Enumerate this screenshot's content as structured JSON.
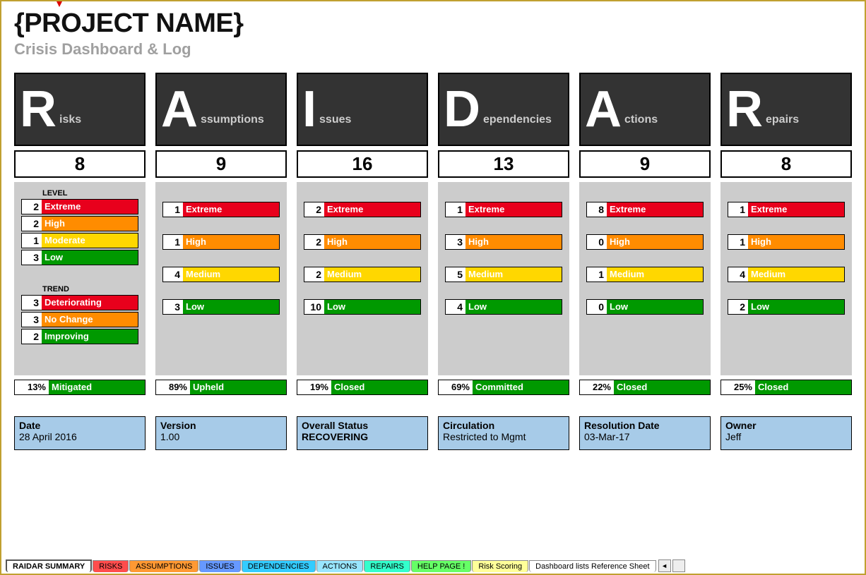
{
  "header": {
    "title": "{PROJECT NAME}",
    "subtitle": "Crisis Dashboard & Log"
  },
  "columns": [
    {
      "letter": "R",
      "word": "isks",
      "count": 8
    },
    {
      "letter": "A",
      "word": "ssumptions",
      "count": 9
    },
    {
      "letter": "I",
      "word": "ssues",
      "count": 16
    },
    {
      "letter": "D",
      "word": "ependencies",
      "count": 13
    },
    {
      "letter": "A",
      "word": "ctions",
      "count": 9
    },
    {
      "letter": "R",
      "word": "epairs",
      "count": 8
    }
  ],
  "risks": {
    "level_label": "LEVEL",
    "levels": [
      {
        "n": 2,
        "label": "Extreme",
        "cls": "c-extreme"
      },
      {
        "n": 2,
        "label": "High",
        "cls": "c-high"
      },
      {
        "n": 1,
        "label": "Moderate",
        "cls": "c-moderate"
      },
      {
        "n": 3,
        "label": "Low",
        "cls": "c-low"
      }
    ],
    "trend_label": "TREND",
    "trends": [
      {
        "n": 3,
        "label": "Deteriorating",
        "cls": "c-deter"
      },
      {
        "n": 3,
        "label": "No Change",
        "cls": "c-nochange"
      },
      {
        "n": 2,
        "label": "Improving",
        "cls": "c-improving"
      }
    ]
  },
  "breakdown": [
    [
      {
        "n": 1,
        "label": "Extreme",
        "cls": "c-extreme"
      },
      {
        "n": 1,
        "label": "High",
        "cls": "c-high"
      },
      {
        "n": 4,
        "label": "Medium",
        "cls": "c-moderate"
      },
      {
        "n": 3,
        "label": "Low",
        "cls": "c-low"
      }
    ],
    [
      {
        "n": 2,
        "label": "Extreme",
        "cls": "c-extreme"
      },
      {
        "n": 2,
        "label": "High",
        "cls": "c-high"
      },
      {
        "n": 2,
        "label": "Medium",
        "cls": "c-moderate"
      },
      {
        "n": 10,
        "label": "Low",
        "cls": "c-low"
      }
    ],
    [
      {
        "n": 1,
        "label": "Extreme",
        "cls": "c-extreme"
      },
      {
        "n": 3,
        "label": "High",
        "cls": "c-high"
      },
      {
        "n": 5,
        "label": "Medium",
        "cls": "c-moderate"
      },
      {
        "n": 4,
        "label": "Low",
        "cls": "c-low"
      }
    ],
    [
      {
        "n": 8,
        "label": "Extreme",
        "cls": "c-extreme"
      },
      {
        "n": 0,
        "label": "High",
        "cls": "c-high"
      },
      {
        "n": 1,
        "label": "Medium",
        "cls": "c-moderate"
      },
      {
        "n": 0,
        "label": "Low",
        "cls": "c-low"
      }
    ],
    [
      {
        "n": 1,
        "label": "Extreme",
        "cls": "c-extreme"
      },
      {
        "n": 1,
        "label": "High",
        "cls": "c-high"
      },
      {
        "n": 4,
        "label": "Medium",
        "cls": "c-moderate"
      },
      {
        "n": 2,
        "label": "Low",
        "cls": "c-low"
      }
    ]
  ],
  "status": [
    {
      "pct": "13%",
      "label": "Mitigated"
    },
    {
      "pct": "89%",
      "label": "Upheld"
    },
    {
      "pct": "19%",
      "label": "Closed"
    },
    {
      "pct": "69%",
      "label": "Committed"
    },
    {
      "pct": "22%",
      "label": "Closed"
    },
    {
      "pct": "25%",
      "label": "Closed"
    }
  ],
  "info": [
    {
      "k": "Date",
      "v": "28 April 2016"
    },
    {
      "k": "Version",
      "v": "1.00"
    },
    {
      "k": "Overall Status",
      "v": "RECOVERING",
      "vb": true
    },
    {
      "k": "Circulation",
      "v": "Restricted to Mgmt"
    },
    {
      "k": "Resolution Date",
      "v": "03-Mar-17"
    },
    {
      "k": "Owner",
      "v": "Jeff"
    }
  ],
  "tabs": [
    {
      "label": "RAIDAR SUMMARY",
      "bg": "#ffffff",
      "active": true
    },
    {
      "label": "RISKS",
      "bg": "#ff4d4d"
    },
    {
      "label": "ASSUMPTIONS",
      "bg": "#ff9933"
    },
    {
      "label": "ISSUES",
      "bg": "#6699ff"
    },
    {
      "label": "DEPENDENCIES",
      "bg": "#33ccff"
    },
    {
      "label": "ACTIONS",
      "bg": "#99e6ff"
    },
    {
      "label": "REPAIRS",
      "bg": "#33ffcc"
    },
    {
      "label": "HELP PAGE !",
      "bg": "#66ff66"
    },
    {
      "label": "Risk Scoring",
      "bg": "#ffff99"
    },
    {
      "label": "Dashboard lists Reference Sheet",
      "bg": "#ffffff"
    }
  ]
}
